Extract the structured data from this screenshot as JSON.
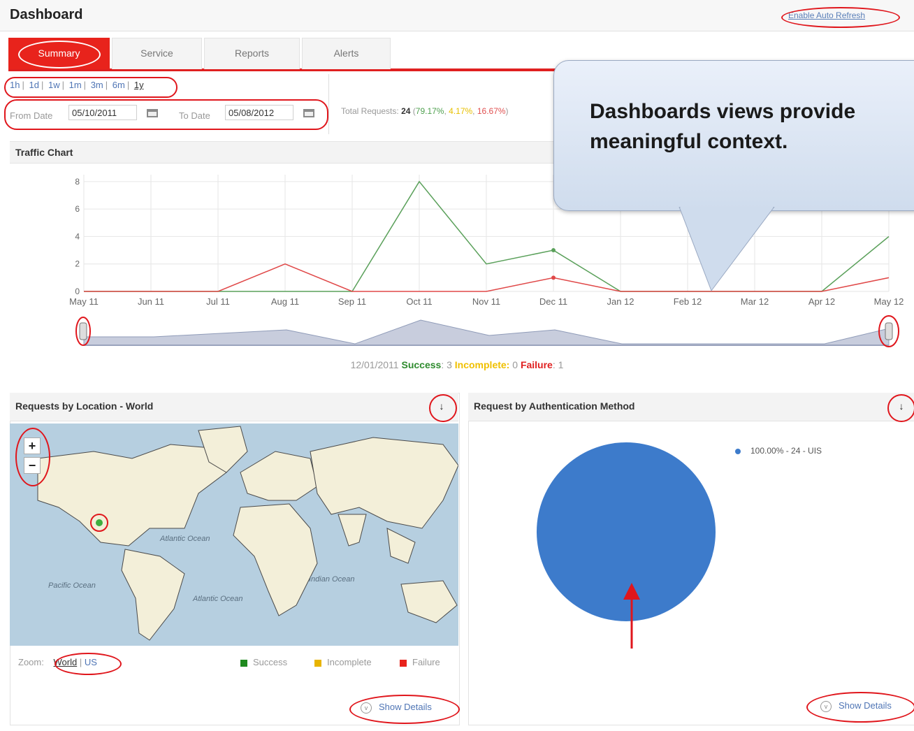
{
  "header": {
    "title": "Dashboard",
    "auto_refresh": "Enable Auto Refresh"
  },
  "tabs": [
    {
      "label": "Summary",
      "active": true
    },
    {
      "label": "Service",
      "active": false
    },
    {
      "label": "Reports",
      "active": false
    },
    {
      "label": "Alerts",
      "active": false
    }
  ],
  "range_links": [
    "1h",
    "1d",
    "1w",
    "1m",
    "3m",
    "6m",
    "1y"
  ],
  "selected_range": "1y",
  "dates": {
    "from_label": "From Date",
    "from_value": "05/10/2011",
    "to_label": "To Date",
    "to_value": "05/08/2012"
  },
  "totals": {
    "label": "Total Requests:",
    "count": "24",
    "pct_success": "79.17%",
    "pct_incomplete": "4.17%",
    "pct_failure": "16.67%"
  },
  "callout": {
    "line1": "Dashboards views provide",
    "line2": "meaningful context."
  },
  "traffic": {
    "title": "Traffic Chart",
    "summary": {
      "date": "12/01/2011",
      "success_label": "Success",
      "success_value": "3",
      "incomplete_label": "Incomplete:",
      "incomplete_value": "0",
      "failure_label": "Failure",
      "failure_value": "1"
    }
  },
  "chart_data": {
    "type": "line",
    "title": "Traffic Chart",
    "x": [
      "May 11",
      "Jun 11",
      "Jul 11",
      "Aug 11",
      "Sep 11",
      "Oct 11",
      "Nov 11",
      "Dec 11",
      "Jan 12",
      "Feb 12",
      "Mar 12",
      "Apr 12",
      "May 12"
    ],
    "series": [
      {
        "name": "Success",
        "color": "#5aa05a",
        "values": [
          0,
          0,
          0,
          0,
          0,
          8,
          2,
          3,
          0,
          0,
          0,
          0,
          4
        ]
      },
      {
        "name": "Failure",
        "color": "#e04848",
        "values": [
          0,
          0,
          0,
          2,
          0,
          0,
          0,
          1,
          0,
          0,
          0,
          0,
          1
        ]
      }
    ],
    "y_ticks": [
      "0",
      "2",
      "4",
      "6",
      "8"
    ],
    "ylim": [
      0,
      8.5
    ],
    "grid": true,
    "highlight_index": 7
  },
  "location_panel": {
    "title": "Requests by Location - World",
    "map_labels": [
      "Atlantic Ocean",
      "Pacific Ocean",
      "Atlantic Ocean",
      "Indian Ocean"
    ],
    "zoom_label": "Zoom:",
    "zoom_world": "World",
    "zoom_us": "US",
    "legend": [
      {
        "label": "Success",
        "color": "#1f8a1f"
      },
      {
        "label": "Incomplete",
        "color": "#e8b400"
      },
      {
        "label": "Failure",
        "color": "#e8231c"
      }
    ],
    "show_details": "Show Details"
  },
  "auth_panel": {
    "title": "Request by Authentication Method",
    "legend_entry": "100.00% - 24 - UIS",
    "pie_color": "#3d7bcb",
    "show_details": "Show Details"
  },
  "icons": {
    "calendar": "calendar-icon",
    "download": "arrow-down-icon",
    "zoom_in": "plus-icon",
    "zoom_out": "minus-icon",
    "details": "chevron-circle-icon"
  }
}
